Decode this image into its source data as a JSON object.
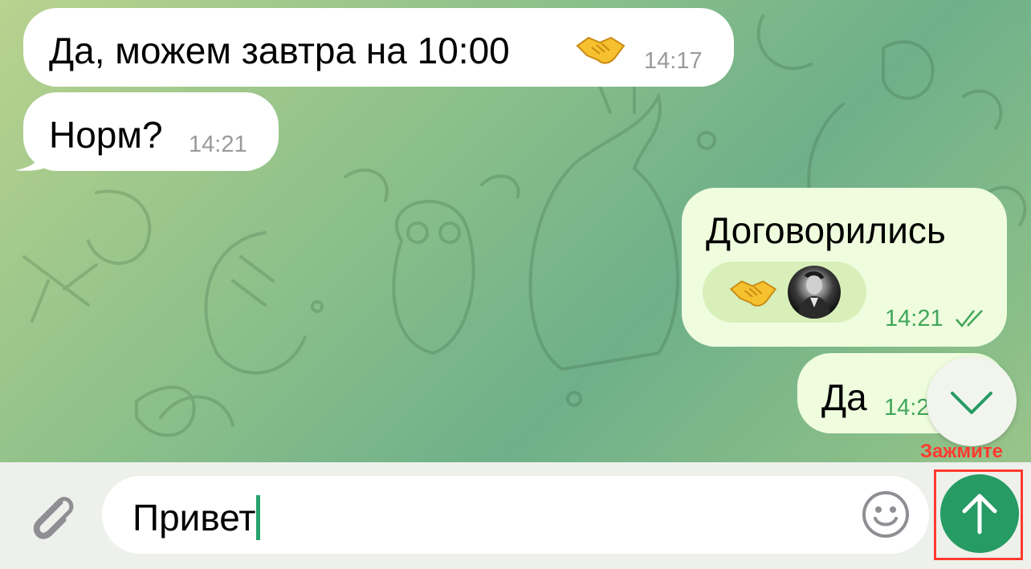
{
  "messages": [
    {
      "direction": "incoming",
      "text": "Да, можем завтра на 10:00",
      "emoji": "handshake-emoji",
      "time": "14:17"
    },
    {
      "direction": "incoming",
      "text": "Норм?",
      "time": "14:21"
    },
    {
      "direction": "outgoing",
      "text": "Договорились",
      "time": "14:21",
      "status": "read",
      "reaction": {
        "emoji": "handshake-emoji",
        "avatar": "user-avatar"
      }
    },
    {
      "direction": "outgoing",
      "text": "Да",
      "time": "14:2"
    }
  ],
  "scroll_down": {
    "icon": "chevron-down-icon"
  },
  "composer": {
    "value": "Привет",
    "attach_icon": "paperclip-icon",
    "emoji_icon": "smiley-icon",
    "send_icon": "arrow-up-icon",
    "hint_label": "Зажмите"
  },
  "colors": {
    "outgoing_bubble": "#effdde",
    "incoming_bubble": "#ffffff",
    "accent_green": "#269b63",
    "time_outgoing": "#41a75a",
    "highlight_red": "#ff3b2f"
  }
}
